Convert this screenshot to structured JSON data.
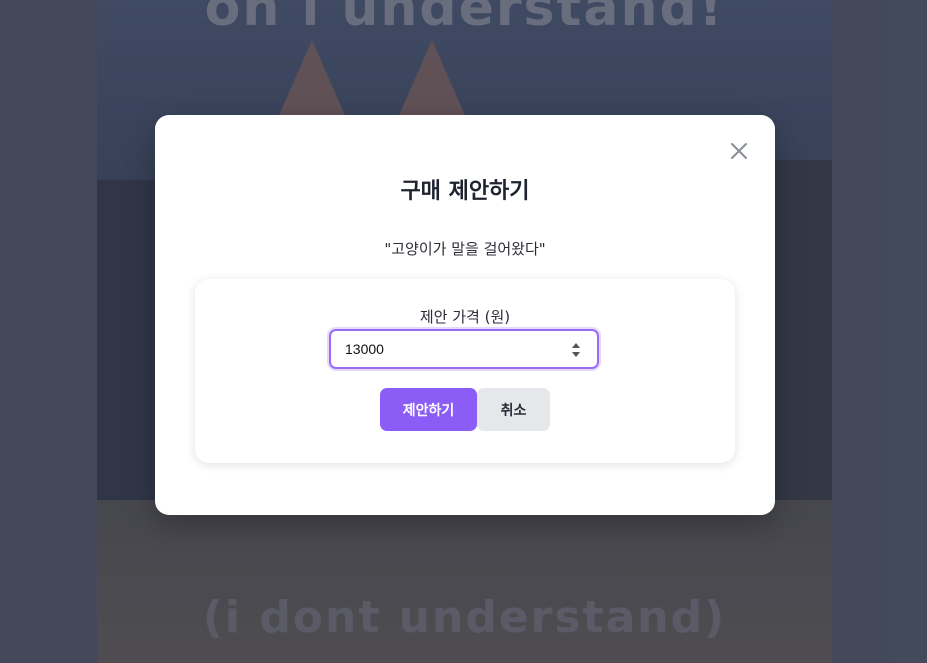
{
  "background": {
    "caption_top": "oh i understand!",
    "caption_bottom": "(i dont understand)"
  },
  "modal": {
    "title": "구매 제안하기",
    "subtitle": "\"고양이가 말을 걸어왔다\"",
    "close_icon": "close-icon",
    "price_label": "제안 가격 (원)",
    "price_value": "13000",
    "submit_label": "제안하기",
    "cancel_label": "취소"
  },
  "colors": {
    "accent": "#8b5cf6",
    "cancel_bg": "#e5e7eb",
    "overlay": "#434a5a"
  }
}
